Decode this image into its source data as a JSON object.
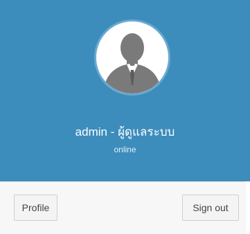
{
  "user_panel": {
    "name": "admin - ผู้ดูแลระบบ",
    "status": "online",
    "avatar_icon": "user-silhouette-icon"
  },
  "footer": {
    "profile_label": "Profile",
    "signout_label": "Sign out"
  },
  "colors": {
    "header_bg": "#3c8dbc",
    "footer_bg": "#f7f7f7"
  }
}
